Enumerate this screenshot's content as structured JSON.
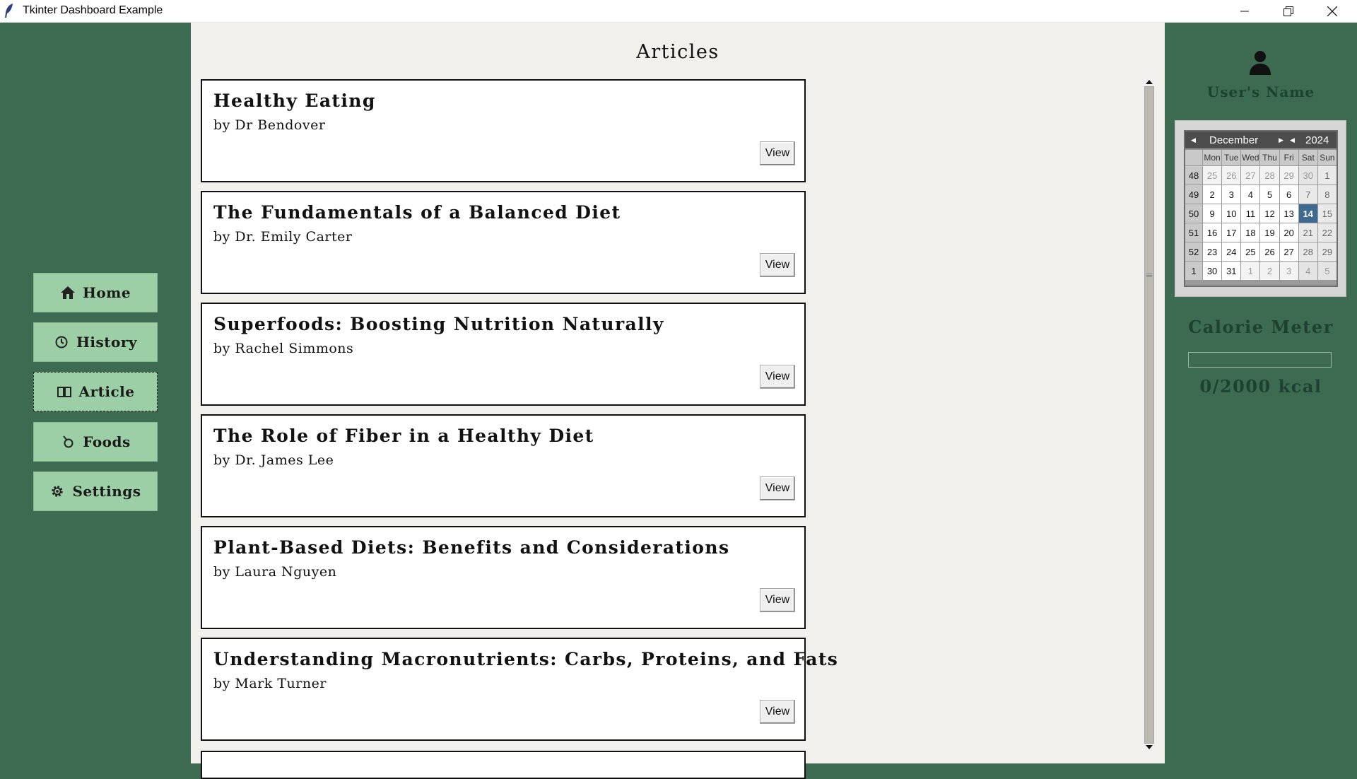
{
  "window": {
    "title": "Tkinter Dashboard Example"
  },
  "sidebar": {
    "items": [
      {
        "label": "Home",
        "icon": "home-icon"
      },
      {
        "label": "History",
        "icon": "clock-icon"
      },
      {
        "label": "Article",
        "icon": "book-icon",
        "active": true
      },
      {
        "label": "Foods",
        "icon": "food-icon"
      },
      {
        "label": "Settings",
        "icon": "gear-icon"
      }
    ]
  },
  "main": {
    "title": "Articles",
    "articles": [
      {
        "title": "Healthy Eating",
        "author": "by Dr Bendover",
        "action": "View"
      },
      {
        "title": "The Fundamentals of a Balanced Diet",
        "author": "by Dr. Emily Carter",
        "action": "View"
      },
      {
        "title": "Superfoods: Boosting Nutrition Naturally",
        "author": "by Rachel Simmons",
        "action": "View"
      },
      {
        "title": "The Role of Fiber in a Healthy Diet",
        "author": "by Dr. James Lee",
        "action": "View"
      },
      {
        "title": "Plant-Based Diets: Benefits and Considerations",
        "author": "by Laura Nguyen",
        "action": "View"
      },
      {
        "title": "Understanding Macronutrients: Carbs, Proteins, and Fats",
        "author": "by Mark Turner",
        "action": "View"
      }
    ]
  },
  "right_panel": {
    "user_name": "User's Name",
    "calendar": {
      "month": "December",
      "year": "2024",
      "day_headers": [
        "Mon",
        "Tue",
        "Wed",
        "Thu",
        "Fri",
        "Sat",
        "Sun"
      ],
      "weeks": [
        {
          "week": "48",
          "days": [
            "25",
            "26",
            "27",
            "28",
            "29",
            "30",
            "1"
          ]
        },
        {
          "week": "49",
          "days": [
            "2",
            "3",
            "4",
            "5",
            "6",
            "7",
            "8"
          ]
        },
        {
          "week": "50",
          "days": [
            "9",
            "10",
            "11",
            "12",
            "13",
            "14",
            "15"
          ]
        },
        {
          "week": "51",
          "days": [
            "16",
            "17",
            "18",
            "19",
            "20",
            "21",
            "22"
          ]
        },
        {
          "week": "52",
          "days": [
            "23",
            "24",
            "25",
            "26",
            "27",
            "28",
            "29"
          ]
        },
        {
          "week": "1",
          "days": [
            "30",
            "31",
            "1",
            "2",
            "3",
            "4",
            "5"
          ]
        }
      ],
      "selected_day": "14"
    },
    "calorie_meter": {
      "title": "Calorie Meter",
      "value_text": "0/2000 kcal",
      "fraction": 0
    }
  },
  "colors": {
    "sidebar_bg": "#3d6b52",
    "button_bg": "#9ccfa6",
    "content_bg": "#f1f0ed",
    "text_dark_green": "#1e4131",
    "calendar_selected": "#3e6990"
  }
}
